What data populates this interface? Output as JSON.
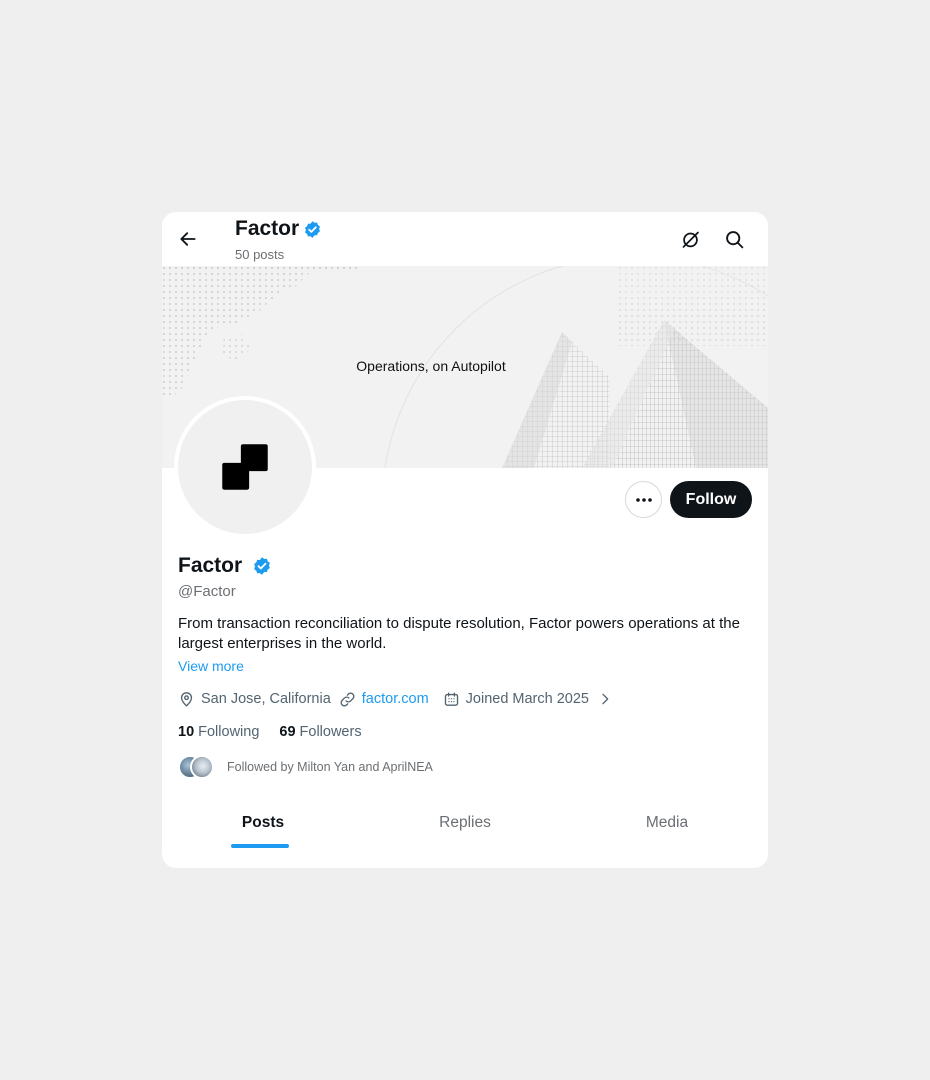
{
  "header": {
    "title": "Factor",
    "posts_count": "50 posts",
    "back_icon": "arrow-left-icon",
    "grok_icon": "grok-icon",
    "search_icon": "search-icon"
  },
  "banner": {
    "tagline": "Operations, on Autopilot"
  },
  "profile": {
    "name": "Factor",
    "handle": "@Factor",
    "verified": true,
    "bio": "From transaction reconciliation to dispute resolution, Factor powers operations at the largest enterprises in the world.",
    "view_more": "View more",
    "location": "San Jose, California",
    "website": "factor.com",
    "joined": "Joined March 2025",
    "following_count": "10",
    "following_label": "Following",
    "followers_count": "69",
    "followers_label": "Followers",
    "followed_by": "Followed by Milton Yan and AprilNEA"
  },
  "actions": {
    "follow_label": "Follow",
    "more_icon": "more-horizontal-icon"
  },
  "tabs": [
    {
      "label": "Posts",
      "active": true
    },
    {
      "label": "Replies",
      "active": false
    },
    {
      "label": "Media",
      "active": false
    }
  ],
  "colors": {
    "accent": "#1d9bf0",
    "primary_text": "#0f1419",
    "secondary_text": "#6b6f73",
    "follow_button": "#0f1419",
    "page_background": "#efefef"
  }
}
